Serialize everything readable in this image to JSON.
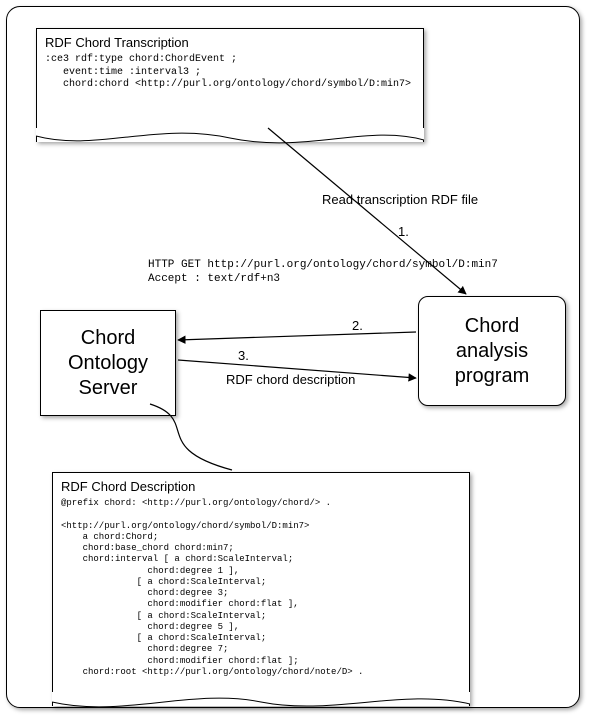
{
  "noteTop": {
    "title": "RDF Chord Transcription",
    "body": ":ce3 rdf:type chord:ChordEvent ;\n   event:time :interval3 ;\n   chord:chord <http://purl.org/ontology/chord/symbol/D:min7>"
  },
  "noteBottom": {
    "title": "RDF Chord Description",
    "body": "@prefix chord: <http://purl.org/ontology/chord/> .\n\n<http://purl.org/ontology/chord/symbol/D:min7>\n    a chord:Chord;\n    chord:base_chord chord:min7;\n    chord:interval [ a chord:ScaleInterval;\n                chord:degree 1 ],\n              [ a chord:ScaleInterval;\n                chord:degree 3;\n                chord:modifier chord:flat ],\n              [ a chord:ScaleInterval;\n                chord:degree 5 ],\n              [ a chord:ScaleInterval;\n                chord:degree 7;\n                chord:modifier chord:flat ];\n    chord:root <http://purl.org/ontology/chord/note/D> ."
  },
  "serverBox": "Chord\nOntology\nServer",
  "analysisBox": "Chord\nanalysis\nprogram",
  "labels": {
    "readFile": "Read transcription RDF file",
    "httpGet": "HTTP GET http://purl.org/ontology/chord/symbol/D:min7\nAccept : text/rdf+n3",
    "rdfDesc": "RDF chord description",
    "n1": "1.",
    "n2": "2.",
    "n3": "3."
  }
}
